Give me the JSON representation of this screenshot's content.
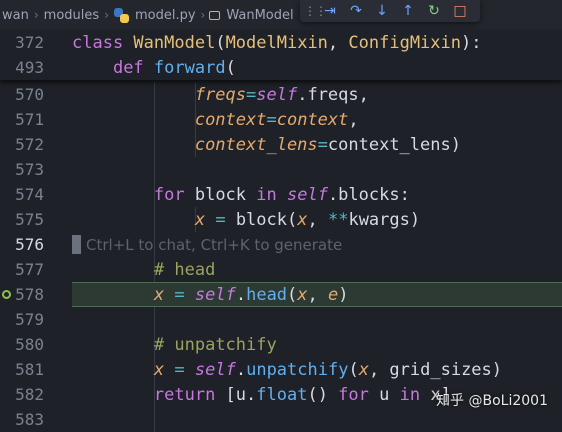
{
  "breadcrumb": {
    "items": [
      "wan",
      "modules",
      "model.py",
      "WanModel"
    ],
    "separator": "›"
  },
  "debug_toolbar": {
    "buttons": [
      "continue-icon",
      "step-over-icon",
      "step-into-icon",
      "step-out-icon",
      "restart-icon",
      "stop-icon"
    ],
    "glyphs": [
      "⇥",
      "↷",
      "↓",
      "↑",
      "↻",
      "□"
    ]
  },
  "sticky_lines": [
    {
      "ln": "372",
      "tokens": [
        [
          "kw",
          "class "
        ],
        [
          "cls",
          "WanModel"
        ],
        [
          "plain",
          "("
        ],
        [
          "cls",
          "ModelMixin"
        ],
        [
          "plain",
          ", "
        ],
        [
          "cls",
          "ConfigMixin"
        ],
        [
          "plain",
          "):"
        ]
      ]
    },
    {
      "ln": "493",
      "tokens": [
        [
          "plain",
          "    "
        ],
        [
          "kw",
          "def "
        ],
        [
          "fn",
          "forward"
        ],
        [
          "plain",
          "("
        ]
      ]
    }
  ],
  "lines": [
    {
      "ln": "570",
      "tokens": [
        [
          "plain",
          "            "
        ],
        [
          "param",
          "freqs"
        ],
        [
          "op",
          "="
        ],
        [
          "self",
          "self"
        ],
        [
          "plain",
          ".freqs,"
        ]
      ]
    },
    {
      "ln": "571",
      "tokens": [
        [
          "plain",
          "            "
        ],
        [
          "param",
          "context"
        ],
        [
          "op",
          "="
        ],
        [
          "var",
          "context"
        ],
        [
          "plain",
          ","
        ]
      ]
    },
    {
      "ln": "572",
      "tokens": [
        [
          "plain",
          "            "
        ],
        [
          "param",
          "context_lens"
        ],
        [
          "op",
          "="
        ],
        [
          "plain",
          "context_lens)"
        ]
      ]
    },
    {
      "ln": "573",
      "tokens": []
    },
    {
      "ln": "574",
      "tokens": [
        [
          "plain",
          "        "
        ],
        [
          "kw",
          "for "
        ],
        [
          "plain",
          "block "
        ],
        [
          "kw",
          "in "
        ],
        [
          "self",
          "self"
        ],
        [
          "plain",
          ".blocks:"
        ]
      ]
    },
    {
      "ln": "575",
      "tokens": [
        [
          "plain",
          "            "
        ],
        [
          "var",
          "x"
        ],
        [
          "plain",
          " "
        ],
        [
          "op",
          "="
        ],
        [
          "plain",
          " block("
        ],
        [
          "var",
          "x"
        ],
        [
          "plain",
          ", "
        ],
        [
          "op",
          "**"
        ],
        [
          "plain",
          "kwargs)"
        ]
      ]
    },
    {
      "ln": "576",
      "tokens": [],
      "active": true
    },
    {
      "ln": "577",
      "tokens": [
        [
          "plain",
          "        "
        ],
        [
          "cmt",
          "# head"
        ]
      ]
    },
    {
      "ln": "578",
      "tokens": [
        [
          "plain",
          "        "
        ],
        [
          "var",
          "x"
        ],
        [
          "plain",
          " "
        ],
        [
          "op",
          "="
        ],
        [
          "plain",
          " "
        ],
        [
          "self",
          "self"
        ],
        [
          "plain",
          "."
        ],
        [
          "fn",
          "head"
        ],
        [
          "plain",
          "("
        ],
        [
          "var",
          "x"
        ],
        [
          "plain",
          ", "
        ],
        [
          "var",
          "e"
        ],
        [
          "plain",
          ")"
        ]
      ],
      "breakpoint": true
    },
    {
      "ln": "579",
      "tokens": []
    },
    {
      "ln": "580",
      "tokens": [
        [
          "plain",
          "        "
        ],
        [
          "cmt",
          "# unpatchify"
        ]
      ]
    },
    {
      "ln": "581",
      "tokens": [
        [
          "plain",
          "        "
        ],
        [
          "var",
          "x"
        ],
        [
          "plain",
          " "
        ],
        [
          "op",
          "="
        ],
        [
          "plain",
          " "
        ],
        [
          "self",
          "self"
        ],
        [
          "plain",
          "."
        ],
        [
          "fn",
          "unpatchify"
        ],
        [
          "plain",
          "("
        ],
        [
          "var",
          "x"
        ],
        [
          "plain",
          ", grid_sizes)"
        ]
      ]
    },
    {
      "ln": "582",
      "tokens": [
        [
          "plain",
          "        "
        ],
        [
          "kw",
          "return "
        ],
        [
          "plain",
          "[u."
        ],
        [
          "fn",
          "float"
        ],
        [
          "plain",
          "() "
        ],
        [
          "kw",
          "for "
        ],
        [
          "plain",
          "u "
        ],
        [
          "kw",
          "in "
        ],
        [
          "plain",
          "x]"
        ]
      ]
    },
    {
      "ln": "583",
      "tokens": []
    }
  ],
  "ghost_hint": "Ctrl+L to chat, Ctrl+K to generate",
  "watermark": "知乎 @BoLi2001",
  "colors": {
    "background": "#1e2127",
    "keyword": "#c678dd",
    "class": "#e5c07b",
    "function": "#61afef",
    "parameter": "#e5a96b",
    "comment": "#9aa35f",
    "breakpoint": "#8bc34a"
  }
}
